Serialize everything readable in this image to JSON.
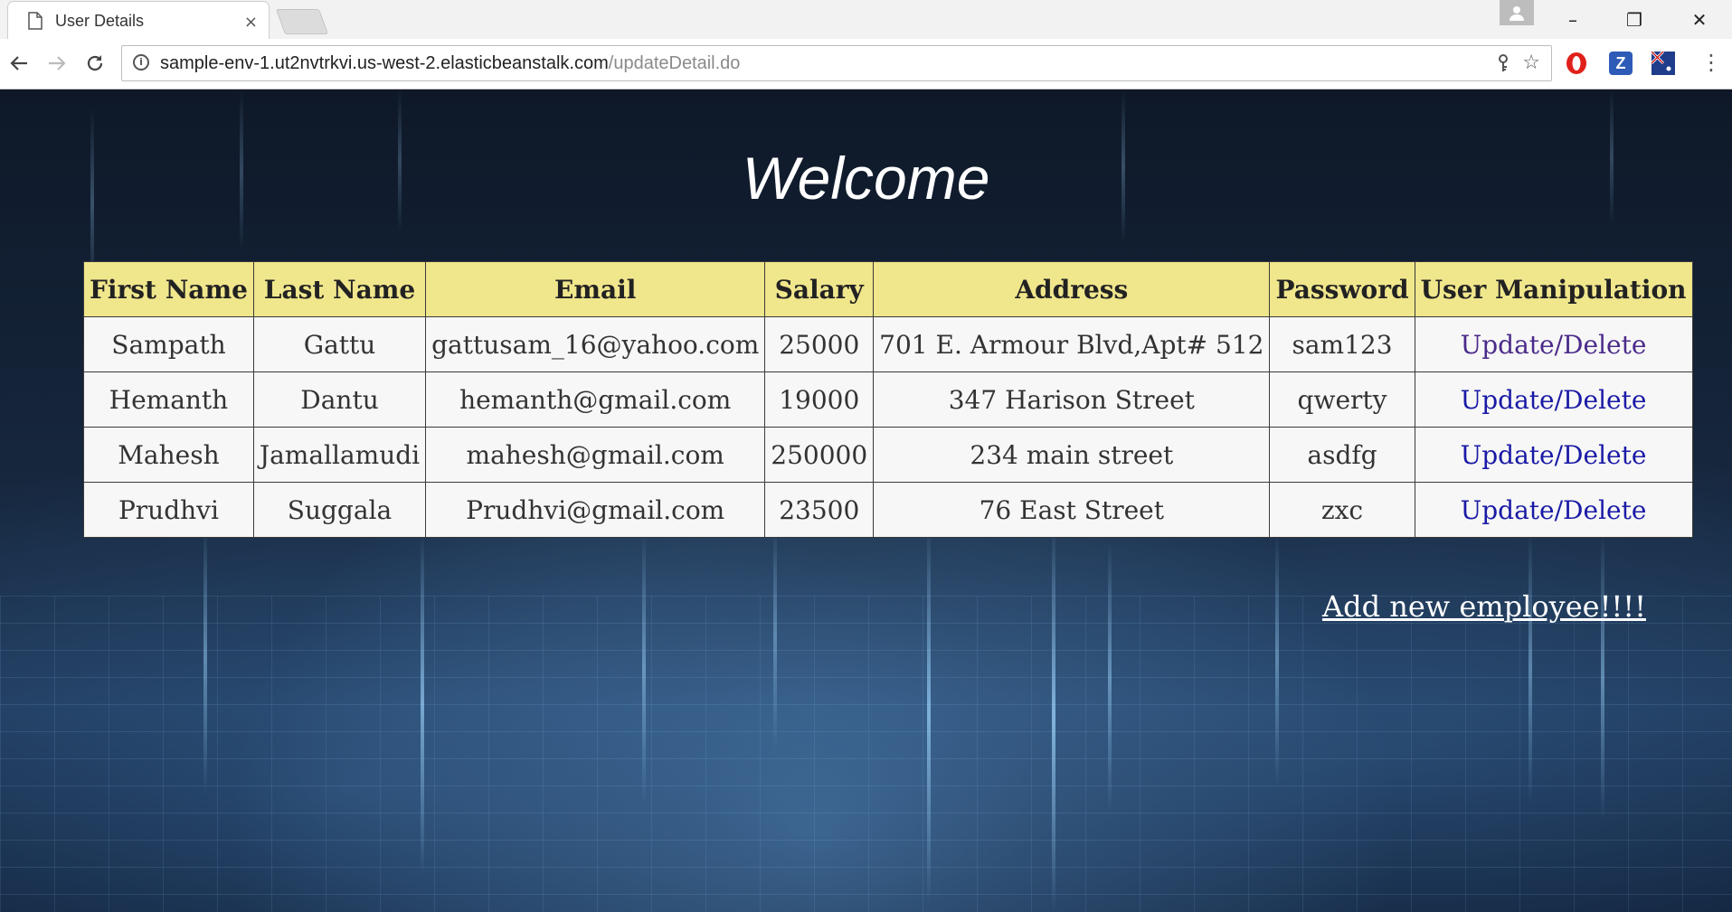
{
  "browser": {
    "tab_title": "User Details",
    "tab_close": "×",
    "url_host": "sample-env-1.ut2nvtrkvi.us-west-2.elasticbeanstalk.com",
    "url_path": "/updateDetail.do",
    "window_controls": {
      "minimize": "–",
      "restore": "❐",
      "close": "✕"
    },
    "extensions": [
      "opera-icon",
      "z-icon",
      "flag-icon"
    ]
  },
  "page": {
    "heading": "Welcome",
    "table": {
      "headers": [
        "First Name",
        "Last Name",
        "Email",
        "Salary",
        "Address",
        "Password",
        "User Manipulation"
      ],
      "rows": [
        {
          "first": "Sampath",
          "last": "Gattu",
          "email": "gattusam_16@yahoo.com",
          "salary": "25000",
          "address": "701 E. Armour Blvd,Apt# 512",
          "password": "sam123",
          "action": "Update/Delete"
        },
        {
          "first": "Hemanth",
          "last": "Dantu",
          "email": "hemanth@gmail.com",
          "salary": "19000",
          "address": "347 Harison Street",
          "password": "qwerty",
          "action": "Update/Delete"
        },
        {
          "first": "Mahesh",
          "last": "Jamallamudi",
          "email": "mahesh@gmail.com",
          "salary": "250000",
          "address": "234 main street",
          "password": "asdfg",
          "action": "Update/Delete"
        },
        {
          "first": "Prudhvi",
          "last": "Suggala",
          "email": "Prudhvi@gmail.com",
          "salary": "23500",
          "address": "76 East Street",
          "password": "zxc",
          "action": "Update/Delete"
        }
      ]
    },
    "add_link": "Add new employee!!!!"
  },
  "colors": {
    "header_bg": "#f0e68c",
    "link": "#1a1aa6",
    "visited_link": "#4b2b8a",
    "table_bg": "#f7f7f7"
  }
}
